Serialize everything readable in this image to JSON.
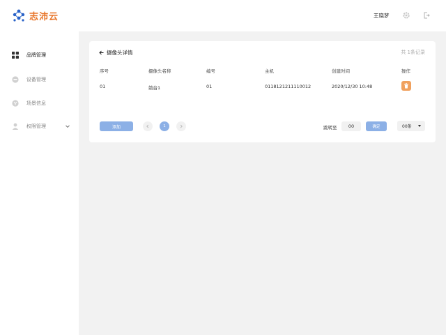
{
  "header": {
    "logo_text": "志沛云",
    "user_name": "王晓梦",
    "icons": [
      "settings-gear-icon",
      "logout-icon"
    ]
  },
  "sidebar": {
    "items": [
      {
        "label": "品牌管理",
        "icon": "grid-icon",
        "active": true
      },
      {
        "label": "设备管理",
        "icon": "device-icon",
        "active": false
      },
      {
        "label": "场景信息",
        "icon": "scene-icon",
        "active": false
      },
      {
        "label": "权限管理",
        "icon": "user-icon",
        "active": false,
        "expandable": true
      }
    ]
  },
  "detail": {
    "back_label": "摄像头详情",
    "total_text": "共 1条记录",
    "columns": [
      "序号",
      "摄像头名称",
      "编号",
      "主机",
      "创建时间",
      "操作"
    ],
    "rows": [
      {
        "index": "01",
        "name": "前台1",
        "code": "01",
        "host": "0118121211110012",
        "created": "2020/12/30 10:48"
      }
    ]
  },
  "pagination": {
    "add_label": "添加",
    "current_page": "1",
    "jump_label": "跳转至",
    "jump_value": "00",
    "confirm_label": "确定",
    "page_size": "00条"
  },
  "colors": {
    "accent_blue": "#8cb0e6",
    "delete_orange": "#f0a15e",
    "logo_orange": "#e8762b",
    "logo_blue": "#2a63c8"
  }
}
